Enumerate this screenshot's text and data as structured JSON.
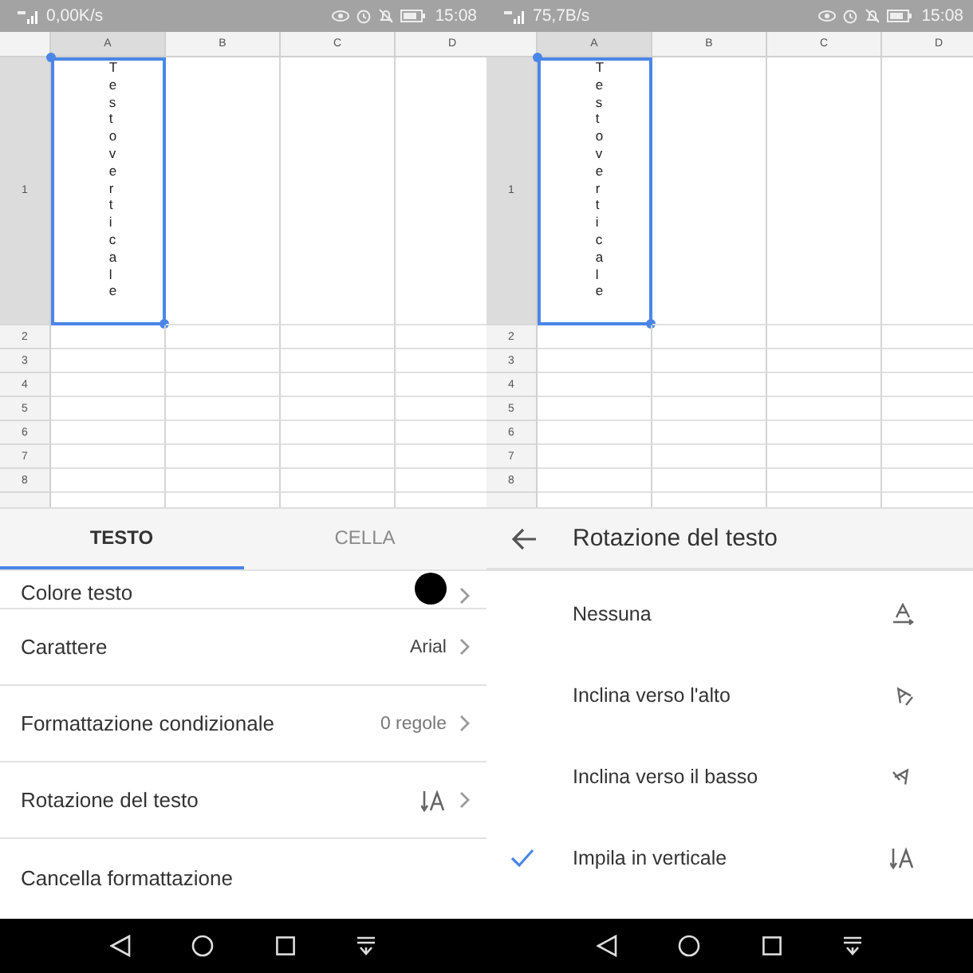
{
  "panels": [
    {
      "status_bar": {
        "net_speed": "0,00K/s",
        "time": "15:08"
      },
      "sheet": {
        "columns": [
          "A",
          "B",
          "C",
          "D"
        ],
        "rows": [
          "1",
          "2",
          "3",
          "4",
          "5",
          "6",
          "7",
          "8"
        ],
        "cell_text": "Testo verticale"
      },
      "bottom_sheet": {
        "kind": "tabs",
        "tabs": [
          {
            "label": "TESTO",
            "selected": true
          },
          {
            "label": "CELLA",
            "selected": false
          }
        ],
        "items": [
          {
            "label": "Colore testo",
            "kind": "color",
            "color": "#000000"
          },
          {
            "label": "Carattere",
            "kind": "value",
            "value": "Arial"
          },
          {
            "label": "Formattazione condizionale",
            "kind": "value",
            "value": "0 regole"
          },
          {
            "label": "Rotazione del testo",
            "kind": "rotation"
          },
          {
            "label": "Cancella formattazione",
            "kind": "action"
          }
        ]
      }
    },
    {
      "status_bar": {
        "net_speed": "75,7B/s",
        "time": "15:08"
      },
      "sheet": {
        "columns": [
          "A",
          "B",
          "C",
          "D"
        ],
        "rows": [
          "1",
          "2",
          "3",
          "4",
          "5",
          "6",
          "7",
          "8"
        ],
        "cell_text": "Testo verticale"
      },
      "bottom_sheet": {
        "kind": "submenu",
        "title": "Rotazione del testo",
        "options": [
          {
            "label": "Nessuna",
            "kind": "none",
            "selected": false
          },
          {
            "label": "Inclina verso l'alto",
            "kind": "up",
            "selected": false
          },
          {
            "label": "Inclina verso il basso",
            "kind": "down",
            "selected": false
          },
          {
            "label": "Impila in verticale",
            "kind": "vertical",
            "selected": true
          }
        ]
      }
    }
  ]
}
